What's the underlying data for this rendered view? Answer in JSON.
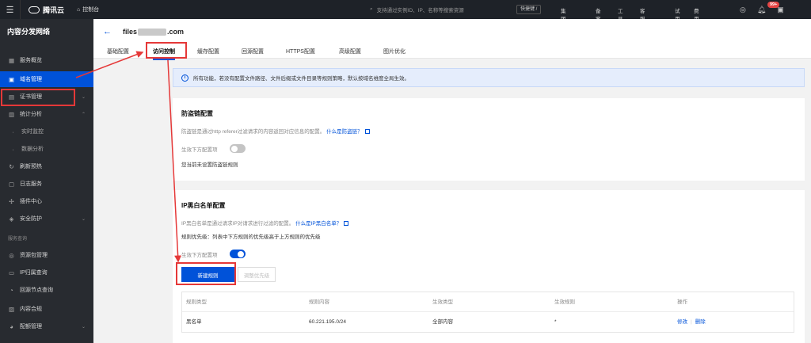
{
  "topbar": {
    "brand": "腾讯云",
    "console": "控制台",
    "search_placeholder": "支持通过实例ID、IP、名称等搜索资源",
    "shortcut": "快捷键 /",
    "links": [
      {
        "label": "集团账号",
        "dot": false
      },
      {
        "label": "备案",
        "dot": false
      },
      {
        "label": "工具",
        "dot": false
      },
      {
        "label": "客服支持",
        "dot": false
      },
      {
        "label": "试用",
        "dot": false
      },
      {
        "label": "费用",
        "dot": true
      }
    ],
    "badge": "99+"
  },
  "sidebar": {
    "title": "内容分发网络",
    "items": [
      {
        "label": "服务概览",
        "icon": "grid-icon",
        "glyph": "▦"
      },
      {
        "label": "域名管理",
        "icon": "domain-icon",
        "glyph": "▣"
      },
      {
        "label": "证书管理",
        "icon": "certificate-icon",
        "glyph": "▤"
      },
      {
        "label": "统计分析",
        "icon": "chart-icon",
        "glyph": "▥"
      },
      {
        "label": "实时监控",
        "icon": "dot-icon",
        "glyph": "·"
      },
      {
        "label": "数据分析",
        "icon": "dot-icon",
        "glyph": "·"
      },
      {
        "label": "刷新预热",
        "icon": "refresh-icon",
        "glyph": "↻"
      },
      {
        "label": "日志服务",
        "icon": "log-icon",
        "glyph": "▢"
      },
      {
        "label": "插件中心",
        "icon": "plugin-icon",
        "glyph": "✣"
      },
      {
        "label": "安全防护",
        "icon": "shield-icon",
        "glyph": "◈"
      },
      {
        "label": "资源包管理",
        "icon": "package-icon",
        "glyph": "◎"
      },
      {
        "label": "IP归属查询",
        "icon": "ip-icon",
        "glyph": "▭"
      },
      {
        "label": "回源节点查询",
        "icon": "search-node-icon",
        "glyph": "◔"
      },
      {
        "label": "内容合规",
        "icon": "compliance-icon",
        "glyph": "▨"
      },
      {
        "label": "配额管理",
        "icon": "quota-icon",
        "glyph": "◕"
      }
    ],
    "group_label": "服务查询"
  },
  "header": {
    "domain_prefix": "files",
    "domain_suffix": ".com",
    "tabs": [
      "基础配置",
      "访问控制",
      "缓存配置",
      "回源配置",
      "HTTPS配置",
      "高级配置",
      "图片优化"
    ],
    "active_tab": "访问控制"
  },
  "info": "所有功能，若没有配置文件路径、文件后缀或文件目录等规则策略，默认按域名维度全局生效。",
  "referer": {
    "title": "防盗链配置",
    "desc": "防盗链是通过http referer过滤请求的内容返回对应信息的配置。",
    "link": "什么是防盗链？",
    "toggle_label": "生效下方配置项",
    "toggle_on": false,
    "empty": "您当前未设置防盗链规则"
  },
  "ipfilter": {
    "title": "IP黑白名单配置",
    "desc": "IP黑白名单是通过请求IP对请求进行过滤的配置。",
    "link": "什么是IP黑白名单？",
    "priority": "规则优先级：列表中下方规则的优先级高于上方规则的优先级",
    "toggle_label": "生效下方配置项",
    "toggle_on": true,
    "new_rule": "新建规则",
    "adjust_priority": "调整优先级",
    "columns": [
      "规则类型",
      "规则内容",
      "生效类型",
      "生效规则",
      "操作"
    ],
    "rows": [
      {
        "type": "黑名单",
        "content": "60.221.195.0/24",
        "effect_type": "全部内容",
        "effect_rule": "*",
        "edit": "修改",
        "delete": "删除"
      }
    ]
  }
}
